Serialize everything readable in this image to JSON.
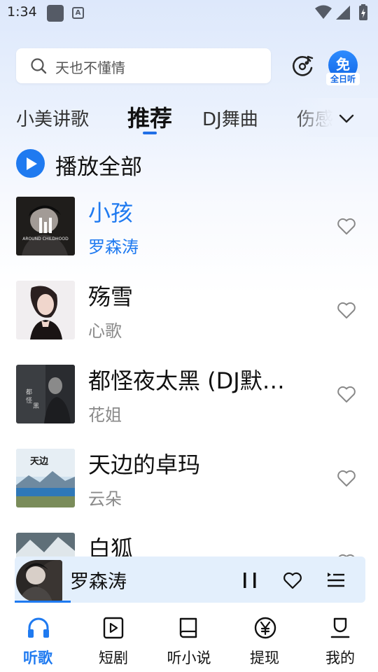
{
  "status_bar": {
    "time": "1:34"
  },
  "search": {
    "placeholder": "天也不懂情"
  },
  "free_badge": {
    "char": "免",
    "label": "全日听"
  },
  "tabs": [
    {
      "label": "小美讲歌",
      "active": false
    },
    {
      "label": "推荐",
      "active": true
    },
    {
      "label": "DJ舞曲",
      "active": false
    },
    {
      "label": "伤感",
      "active": false
    }
  ],
  "play_all": {
    "label": "播放全部"
  },
  "songs": [
    {
      "title": "小孩",
      "artist": "罗森涛",
      "playing": true
    },
    {
      "title": "殇雪",
      "artist": "心歌",
      "playing": false
    },
    {
      "title": "都怪夜太黑 (DJ默…",
      "artist": "花姐",
      "playing": false
    },
    {
      "title": "天边的卓玛",
      "artist": "云朵",
      "playing": false
    },
    {
      "title": "白狐",
      "artist": "",
      "playing": false
    }
  ],
  "mini_player": {
    "artist": "罗森涛",
    "progress_fraction": 0.16
  },
  "bottom_nav": [
    {
      "label": "听歌",
      "icon": "headphones-icon",
      "active": true
    },
    {
      "label": "短剧",
      "icon": "video-icon",
      "active": false
    },
    {
      "label": "听小说",
      "icon": "book-icon",
      "active": false
    },
    {
      "label": "提现",
      "icon": "yen-icon",
      "active": false
    },
    {
      "label": "我的",
      "icon": "profile-icon",
      "active": false
    }
  ],
  "colors": {
    "accent": "#1f7af0",
    "text": "#111111",
    "secondary_text": "#8a8a8a"
  }
}
